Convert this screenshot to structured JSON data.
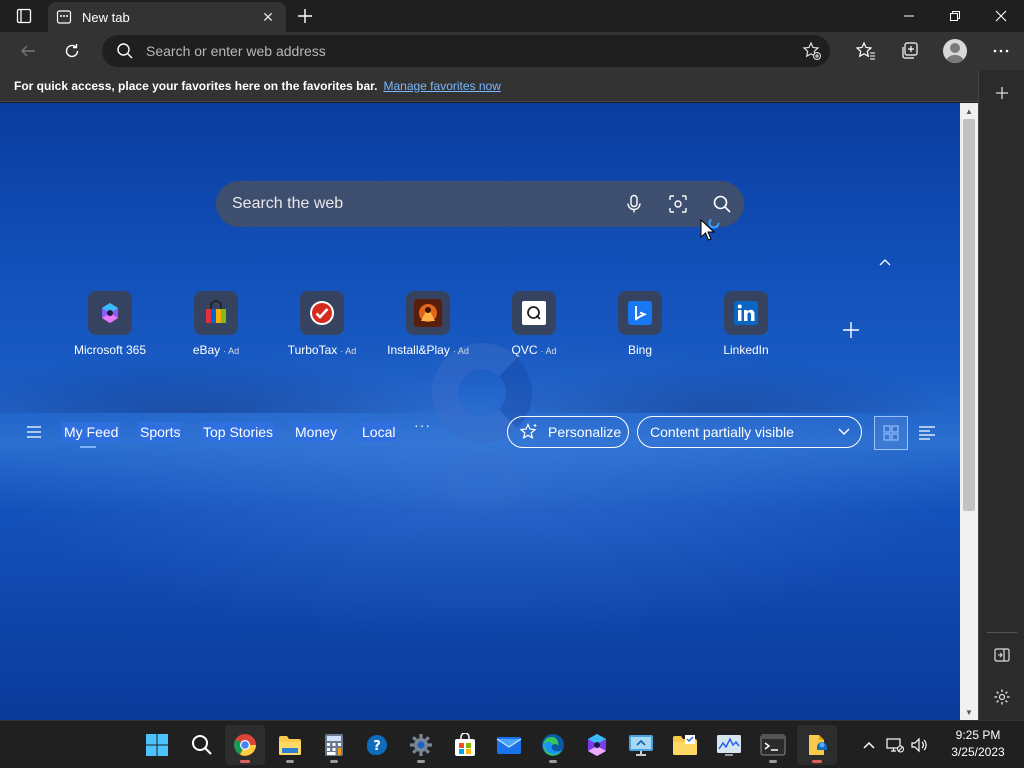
{
  "browser": {
    "tab_title": "New tab",
    "address_placeholder": "Search or enter web address"
  },
  "favorites_bar": {
    "message": "For quick access, place your favorites here on the favorites bar.",
    "link": "Manage favorites now"
  },
  "newtab": {
    "search_placeholder": "Search the web",
    "quick_links": [
      {
        "label": "Microsoft 365",
        "ad": ""
      },
      {
        "label": "eBay",
        "ad": "· Ad"
      },
      {
        "label": "TurboTax",
        "ad": "· Ad"
      },
      {
        "label": "Install&Play",
        "ad": "· Ad"
      },
      {
        "label": "QVC",
        "ad": "· Ad"
      },
      {
        "label": "Bing",
        "ad": ""
      },
      {
        "label": "LinkedIn",
        "ad": ""
      }
    ],
    "feed_nav": [
      "My Feed",
      "Sports",
      "Top Stories",
      "Money",
      "Local"
    ],
    "more": "···",
    "personalize": "Personalize",
    "content_visibility": "Content partially visible"
  },
  "taskbar": {
    "time": "9:25 PM",
    "date": "3/25/2023"
  },
  "colors": {
    "accent": "#2f6fe0",
    "link": "#79b8ff",
    "chrome_dark": "#1f1f1f",
    "chrome": "#333333"
  }
}
